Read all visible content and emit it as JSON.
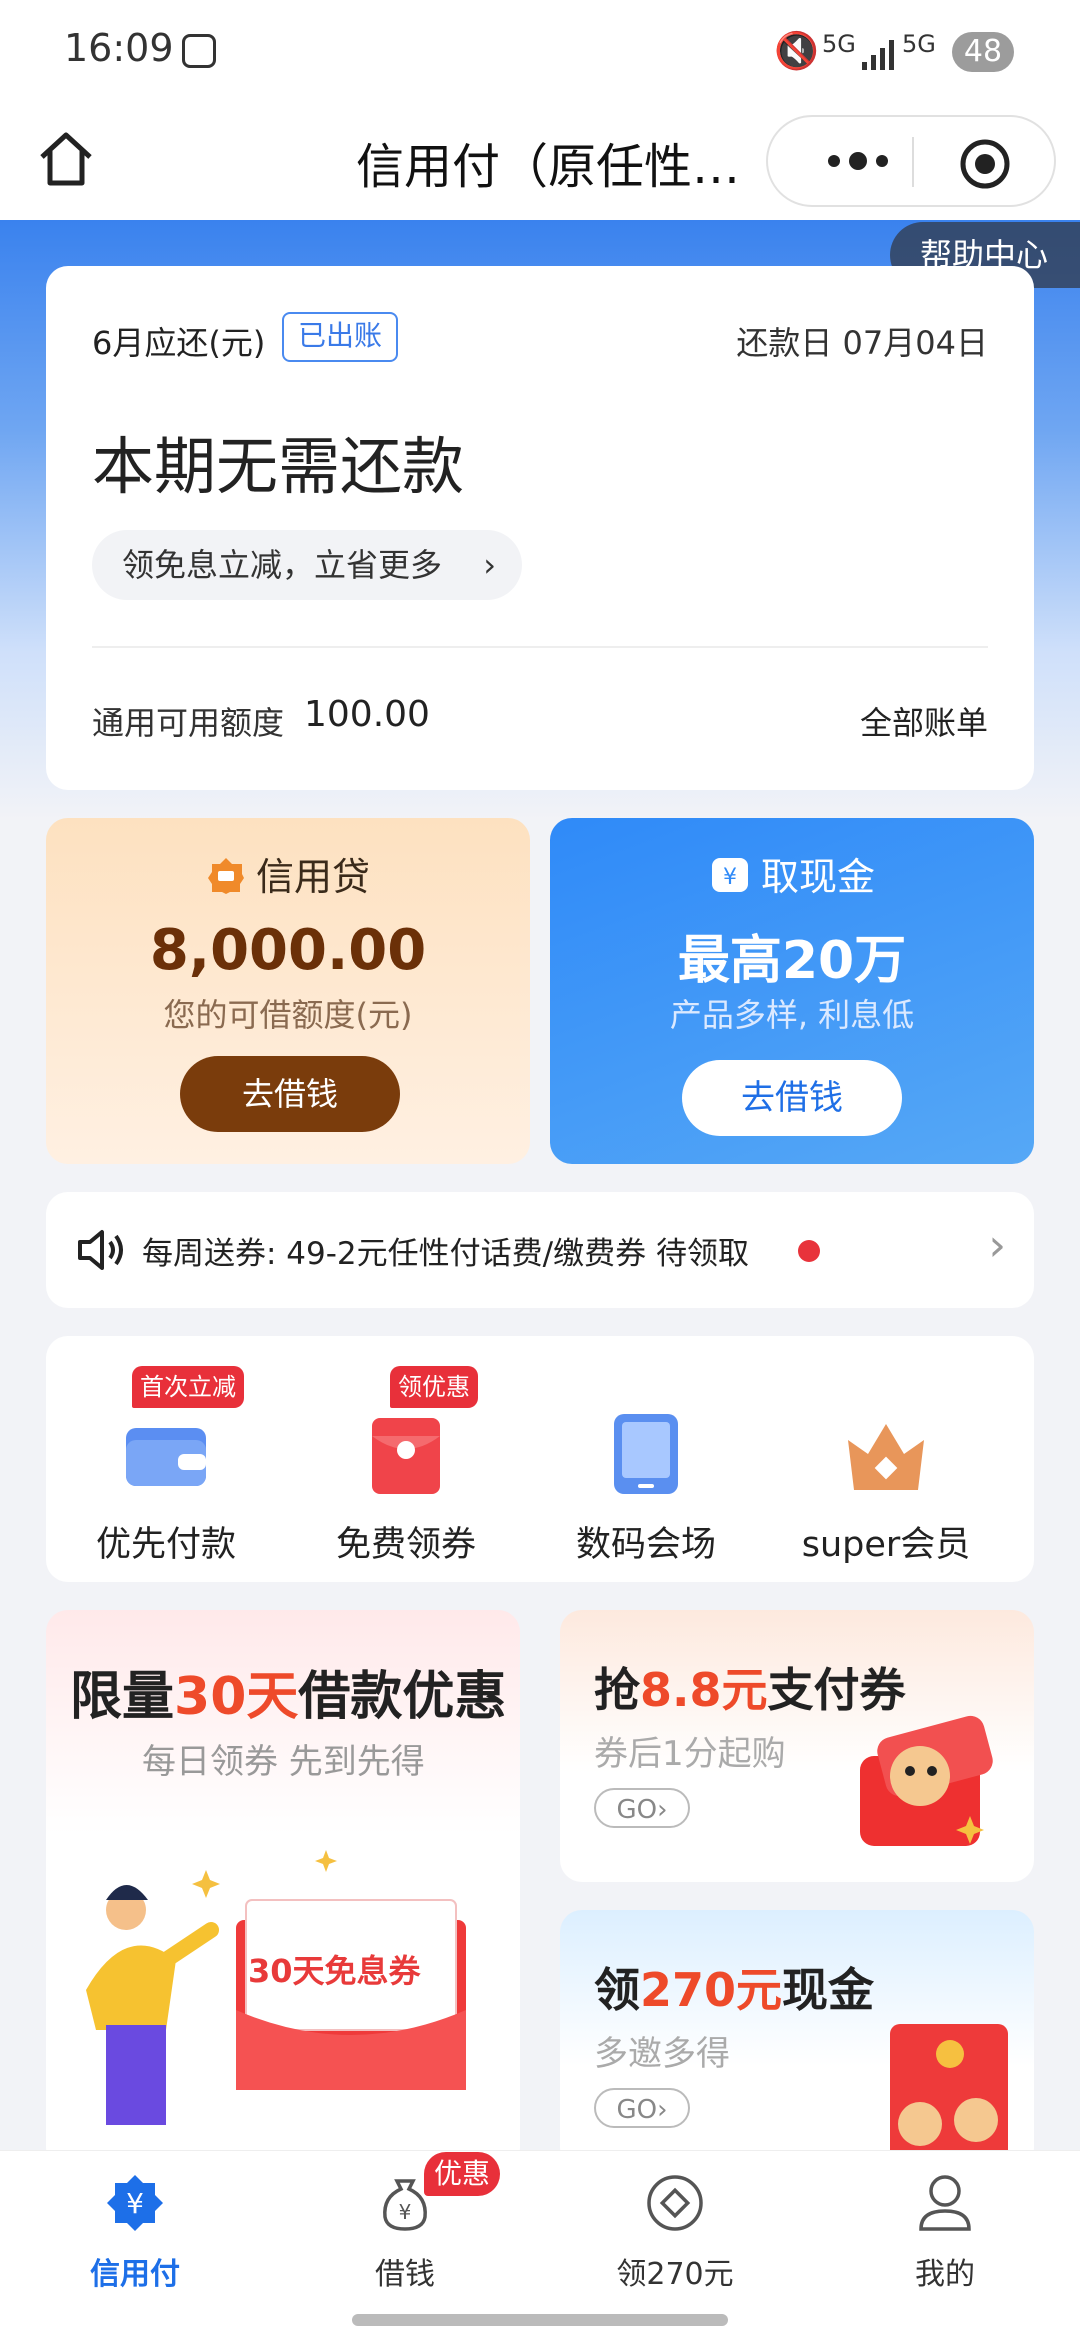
{
  "status_bar": {
    "time": "16:09",
    "signal1": "5G",
    "signal2": "5G",
    "battery": "48"
  },
  "header": {
    "title": "信用付（原任性…"
  },
  "help_center": "帮助中心",
  "bill": {
    "due_label": "6月应还(元)",
    "status_badge": "已出账",
    "repay_date": "还款日 07月04日",
    "main_text": "本期无需还款",
    "promo_text": "领免息立减，立省更多",
    "limit_label": "通用可用额度",
    "limit_value": "100.00",
    "all_bills": "全部账单"
  },
  "credit_loan": {
    "title": "信用贷",
    "amount": "8,000.00",
    "subtitle": "您的可借额度(元)",
    "button": "去借钱"
  },
  "cash": {
    "title": "取现金",
    "amount": "最高20万",
    "subtitle": "产品多样, 利息低",
    "button": "去借钱"
  },
  "notice": {
    "text": "每周送券:  49-2元任性付话费/缴费券 待领取"
  },
  "shortcuts": [
    {
      "label": "优先付款",
      "tag": "首次立减",
      "icon": "wallet-icon"
    },
    {
      "label": "免费领券",
      "tag": "领优惠",
      "icon": "red-envelope-icon"
    },
    {
      "label": "数码会场",
      "tag": "",
      "icon": "tablet-icon"
    },
    {
      "label": "super会员",
      "tag": "",
      "icon": "crown-icon"
    }
  ],
  "promo_loan": {
    "title_a": "限量",
    "title_b": "30天",
    "title_c": "借款优惠",
    "subtitle": "每日领券 先到先得",
    "coupon": "30天免息券"
  },
  "promo_pay": {
    "title_a": "抢",
    "title_b": "8.8元",
    "title_c": "支付券",
    "subtitle": "券后1分起购",
    "go": "GO"
  },
  "promo_cash": {
    "title_a": "领",
    "title_b": "270元",
    "title_c": "现金",
    "subtitle": "多邀多得",
    "go": "GO"
  },
  "tabs": [
    {
      "label": "信用付",
      "icon": "credit-pay-icon"
    },
    {
      "label": "借钱",
      "icon": "money-bag-icon"
    },
    {
      "label": "领270元",
      "icon": "coin-icon"
    },
    {
      "label": "我的",
      "icon": "profile-icon"
    }
  ],
  "tab_badge": "优惠",
  "colors": {
    "brand_blue": "#1d6fe8",
    "loan_brown": "#7a3c0c",
    "alert_red": "#e8303a"
  }
}
